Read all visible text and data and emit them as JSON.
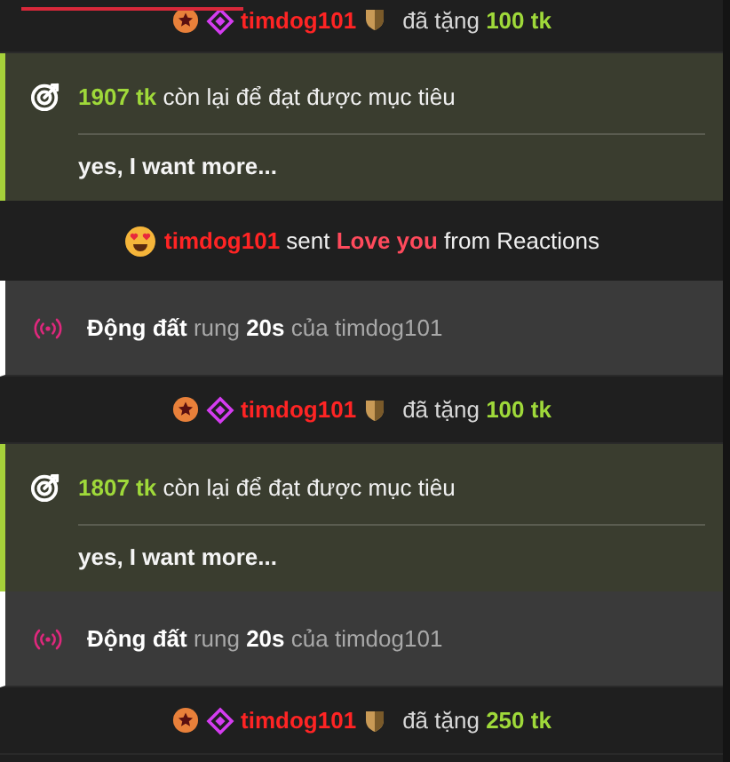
{
  "feed": [
    {
      "kind": "gift",
      "user": "timdog101",
      "verb": "đã tặng",
      "amount": "100 tk"
    },
    {
      "kind": "goal",
      "amount": "1907 tk",
      "text": "còn lại để đạt được mục tiêu",
      "message": "yes, I want more..."
    },
    {
      "kind": "reaction",
      "user": "timdog101",
      "verb": "sent",
      "item": "Love you",
      "source": "from Reactions"
    },
    {
      "kind": "effect",
      "name": "Động đất",
      "verb": "rung",
      "duration": "20s",
      "suffix": "của timdog101"
    },
    {
      "kind": "gift",
      "user": "timdog101",
      "verb": "đã tặng",
      "amount": "100 tk"
    },
    {
      "kind": "goal",
      "amount": "1807 tk",
      "text": "còn lại để đạt được mục tiêu",
      "message": "yes, I want more..."
    },
    {
      "kind": "effect",
      "name": "Động đất",
      "verb": "rung",
      "duration": "20s",
      "suffix": "của timdog101"
    },
    {
      "kind": "gift",
      "user": "timdog101",
      "verb": "đã tặng",
      "amount": "250 tk"
    }
  ]
}
